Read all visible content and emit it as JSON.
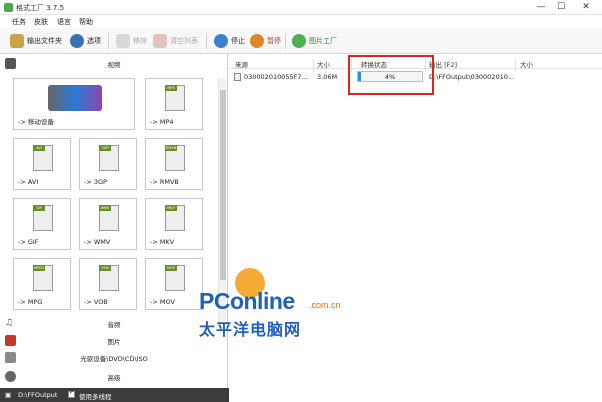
{
  "window": {
    "title": "格式工厂 3.7.5",
    "min": "—",
    "max": "☐",
    "close": "✕"
  },
  "menu": [
    "任务",
    "皮肤",
    "语言",
    "帮助"
  ],
  "toolbar": {
    "output_folder": "输出文件夹",
    "options": "选项",
    "remove": "移除",
    "clear_list": "清空列表",
    "stop": "停止",
    "pause": "暂停",
    "picture_factory": "图片工厂"
  },
  "left": {
    "categories": {
      "video": "视频",
      "audio": "音频",
      "picture": "图片",
      "rom": "光驱设备\\DVD\\CD\\ISO",
      "advanced": "高级"
    },
    "tiles": [
      {
        "label": "-> 移动设备",
        "fmt": ""
      },
      {
        "label": "-> MP4",
        "fmt": "MP4"
      },
      {
        "label": "-> AVI",
        "fmt": "AVI"
      },
      {
        "label": "-> 3GP",
        "fmt": "3GP"
      },
      {
        "label": "-> RMVB",
        "fmt": "RMVB"
      },
      {
        "label": "-> GIF",
        "fmt": "GIF"
      },
      {
        "label": "-> WMV",
        "fmt": "WMV"
      },
      {
        "label": "-> MKV",
        "fmt": "MKV"
      },
      {
        "label": "-> MPG",
        "fmt": "MPEG"
      },
      {
        "label": "-> VOB",
        "fmt": "VOB"
      },
      {
        "label": "-> MOV",
        "fmt": "MOV"
      }
    ]
  },
  "statusbar": {
    "path": "D:\\FFOutput",
    "multithread": "使用多线程"
  },
  "table": {
    "headers": {
      "source": "来源",
      "size": "大小",
      "status": "转换状态",
      "output": "输出 [F2]",
      "out_size": "大小"
    },
    "row": {
      "source": "030002010055F7...",
      "size": "3.06M",
      "progress_pct": 4,
      "progress_text": "4%",
      "output": "D:\\FFOutput\\030002010..."
    }
  },
  "watermark": {
    "brand": "PConline",
    "domain": ".com.cn",
    "cn": "太平洋电脑网"
  },
  "colors": {
    "progress": "#2a8de0",
    "highlight_box": "#d9261c",
    "brand_blue": "#1f5fbf",
    "brand_orange": "#e86b17"
  }
}
